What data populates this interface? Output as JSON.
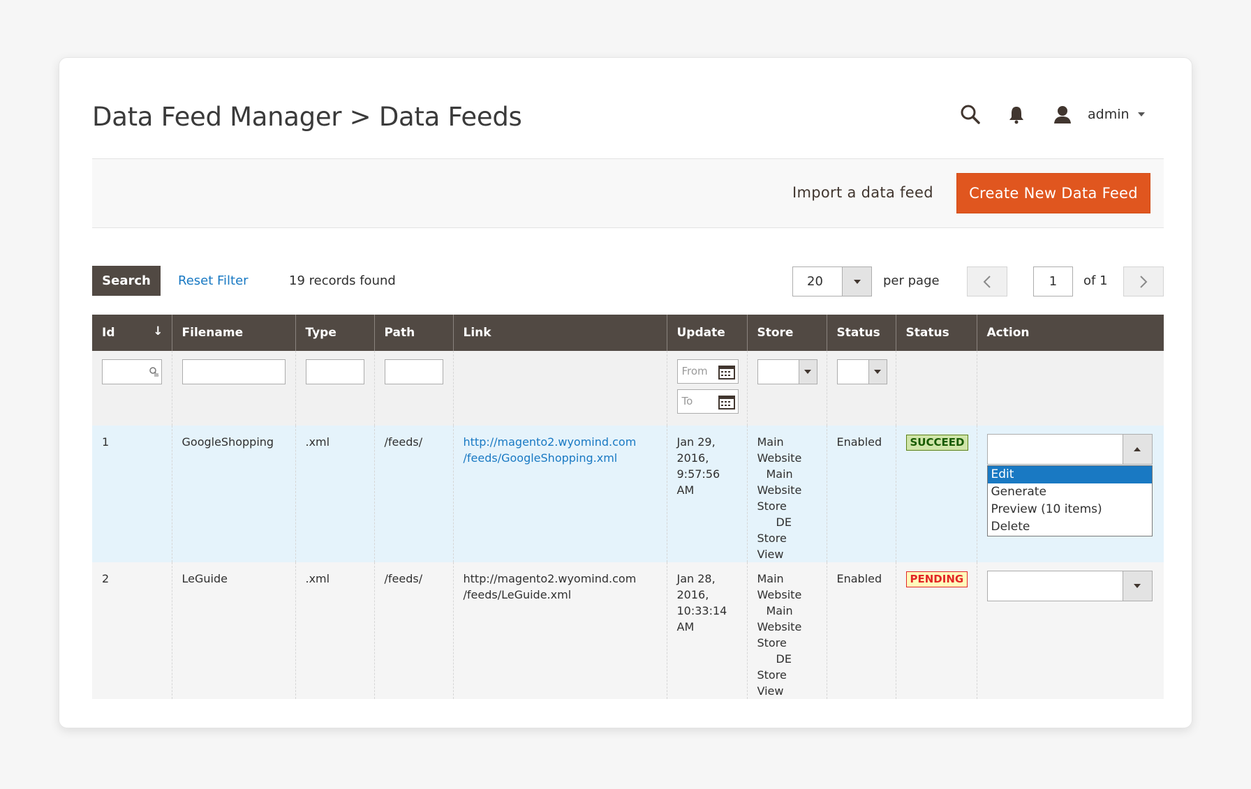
{
  "page": {
    "title": "Data Feed Manager > Data Feeds"
  },
  "header": {
    "admin_label": "admin",
    "icons": [
      "search-icon",
      "bell-icon",
      "user-icon"
    ]
  },
  "actions": {
    "import_label": "Import a data feed",
    "create_label": "Create New Data Feed",
    "create_color": "#e0561f"
  },
  "toolbar": {
    "search_label": "Search",
    "reset_label": "Reset Filter",
    "records_text": "19 records found",
    "per_page_value": "20",
    "per_page_label": "per page",
    "page_value": "1",
    "page_of": "of 1"
  },
  "grid": {
    "columns": [
      "Id",
      "Filename",
      "Type",
      "Path",
      "Link",
      "Update",
      "Store",
      "Status",
      "Status",
      "Action"
    ],
    "filters": {
      "date_from": "From",
      "date_to": "To"
    },
    "rows": [
      {
        "id": "1",
        "filename": "GoogleShopping",
        "type": ".xml",
        "path": "/feeds/",
        "link_1": "http://magento2.wyomind.com",
        "link_2": "/feeds/GoogleShopping.xml",
        "update": [
          "Jan 29,",
          "2016,",
          "9:57:56 AM"
        ],
        "store": [
          "Main",
          "Website",
          "Main",
          "Website",
          "Store",
          "DE",
          "Store View"
        ],
        "status": "Enabled",
        "badge": "SUCCEED",
        "action_menu": [
          "Edit",
          "Generate",
          "Preview (10 items)",
          "Delete"
        ]
      },
      {
        "id": "2",
        "filename": "LeGuide",
        "type": ".xml",
        "path": "/feeds/",
        "link_1": "http://magento2.wyomind.com",
        "link_2": "/feeds/LeGuide.xml",
        "update": [
          "Jan 28,",
          "2016,",
          "10:33:14",
          "AM"
        ],
        "store": [
          "Main",
          "Website",
          "Main",
          "Website",
          "Store",
          "DE",
          "Store View"
        ],
        "status": "Enabled",
        "badge": "PENDING"
      }
    ]
  },
  "colors": {
    "header_bg": "#514943",
    "link": "#1979c3",
    "selected_row": "#e5f3fb"
  }
}
